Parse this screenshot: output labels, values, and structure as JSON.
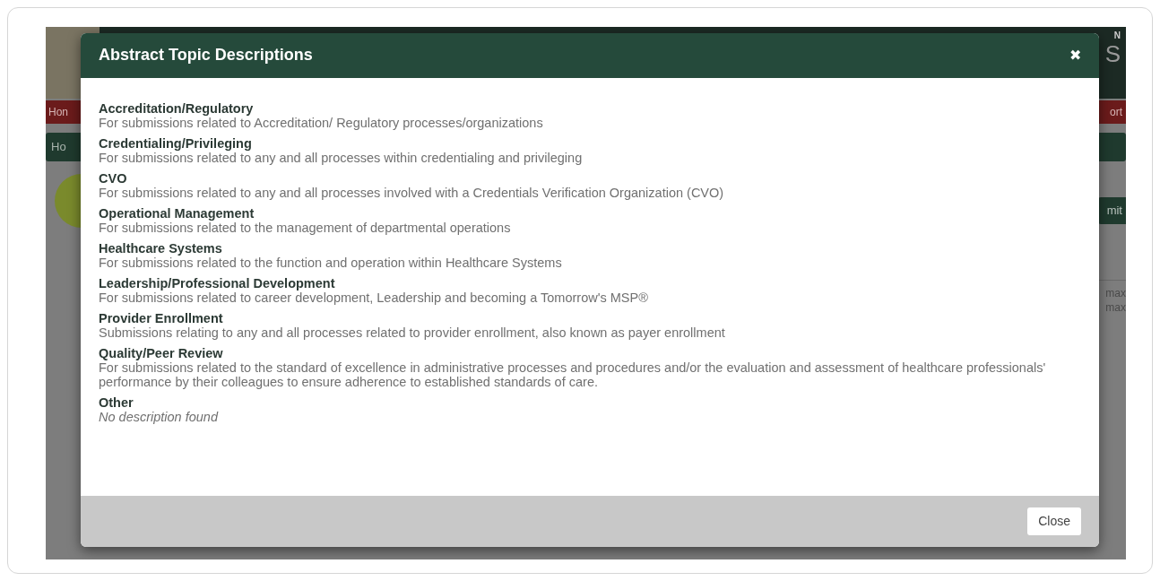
{
  "background_page": {
    "header_fragments": [
      "N",
      "S"
    ],
    "nav_left": "Hon",
    "nav_right": "ort",
    "breadcrumb_left": "Ho",
    "submit_fragment": "mit",
    "field_notes": [
      "max",
      "max"
    ]
  },
  "modal": {
    "title": "Abstract Topic Descriptions",
    "close_icon": "✖",
    "topics": [
      {
        "name": "Accreditation/Regulatory",
        "description": "For submissions related to Accreditation/ Regulatory processes/organizations",
        "kind": "normal"
      },
      {
        "name": "Credentialing/Privileging",
        "description": "For submissions related to any and all processes within credentialing and privileging",
        "kind": "normal"
      },
      {
        "name": "CVO",
        "description": "For submissions related to any and all processes involved with a Credentials Verification Organization (CVO)",
        "kind": "normal"
      },
      {
        "name": "Operational Management",
        "description": "For submissions related to the management of departmental operations",
        "kind": "normal"
      },
      {
        "name": "Healthcare Systems",
        "description": "For submissions related to the function and operation within Healthcare Systems",
        "kind": "normal"
      },
      {
        "name": "Leadership/Professional Development",
        "description": "For submissions related to career development, Leadership and becoming a Tomorrow's MSP®",
        "kind": "normal"
      },
      {
        "name": "Provider Enrollment",
        "description": "Submissions relating to any and all processes related to provider enrollment, also known as payer enrollment",
        "kind": "normal"
      },
      {
        "name": "Quality/Peer Review",
        "description": "For submissions related to the standard of excellence in administrative processes and procedures and/or the evaluation and assessment of healthcare professionals' performance by their colleagues to ensure adherence to established standards of care.",
        "kind": "normal"
      },
      {
        "name": "Other",
        "description": "No description found",
        "kind": "empty"
      }
    ],
    "footer_button": "Close"
  }
}
